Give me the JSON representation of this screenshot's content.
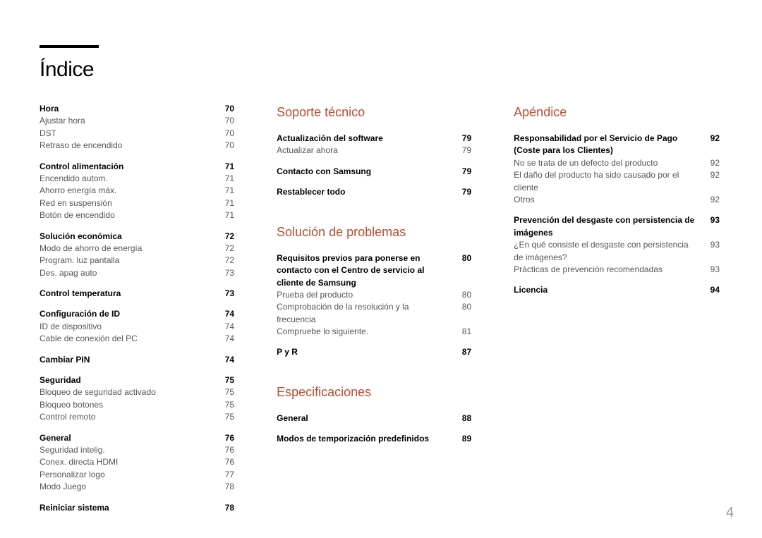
{
  "title": "Índice",
  "page_number": "4",
  "col1": {
    "groups": [
      {
        "items": [
          {
            "label": "Hora",
            "page": "70",
            "bold": true
          },
          {
            "label": "Ajustar hora",
            "page": "70"
          },
          {
            "label": "DST",
            "page": "70"
          },
          {
            "label": "Retraso de encendido",
            "page": "70"
          }
        ]
      },
      {
        "items": [
          {
            "label": "Control alimentación",
            "page": "71",
            "bold": true
          },
          {
            "label": "Encendido autom.",
            "page": "71"
          },
          {
            "label": "Ahorro energía máx.",
            "page": "71"
          },
          {
            "label": "Red en suspensión",
            "page": "71"
          },
          {
            "label": "Botón de encendido",
            "page": "71"
          }
        ]
      },
      {
        "items": [
          {
            "label": "Solución económica",
            "page": "72",
            "bold": true
          },
          {
            "label": "Modo de ahorro de energía",
            "page": "72"
          },
          {
            "label": "Program. luz pantalla",
            "page": "72"
          },
          {
            "label": "Des. apag auto",
            "page": "73"
          }
        ]
      },
      {
        "items": [
          {
            "label": "Control temperatura",
            "page": "73",
            "bold": true
          }
        ]
      },
      {
        "items": [
          {
            "label": "Configuración de ID",
            "page": "74",
            "bold": true
          },
          {
            "label": "ID de dispositivo",
            "page": "74"
          },
          {
            "label": "Cable de conexión del PC",
            "page": "74"
          }
        ]
      },
      {
        "items": [
          {
            "label": "Cambiar PIN",
            "page": "74",
            "bold": true
          }
        ]
      },
      {
        "items": [
          {
            "label": "Seguridad",
            "page": "75",
            "bold": true
          },
          {
            "label": "Bloqueo de seguridad activado",
            "page": "75"
          },
          {
            "label": "Bloqueo botones",
            "page": "75"
          },
          {
            "label": "Control remoto",
            "page": "75"
          }
        ]
      },
      {
        "items": [
          {
            "label": "General",
            "page": "76",
            "bold": true
          },
          {
            "label": "Seguridad intelig.",
            "page": "76"
          },
          {
            "label": "Conex. directa HDMI",
            "page": "76"
          },
          {
            "label": "Personalizar logo",
            "page": "77"
          },
          {
            "label": "Modo Juego",
            "page": "78"
          }
        ]
      },
      {
        "items": [
          {
            "label": "Reiniciar sistema",
            "page": "78",
            "bold": true
          }
        ]
      }
    ]
  },
  "col2": {
    "sections": [
      {
        "heading": "Soporte técnico",
        "groups": [
          {
            "items": [
              {
                "label": "Actualización del software",
                "page": "79",
                "bold": true
              },
              {
                "label": "Actualizar ahora",
                "page": "79"
              }
            ]
          },
          {
            "items": [
              {
                "label": "Contacto con Samsung",
                "page": "79",
                "bold": true
              }
            ]
          },
          {
            "items": [
              {
                "label": "Restablecer todo",
                "page": "79",
                "bold": true
              }
            ]
          }
        ]
      },
      {
        "heading": "Solución de problemas",
        "groups": [
          {
            "items": [
              {
                "label": "Requisitos previos para ponerse en contacto con el Centro de servicio al cliente de Samsung",
                "page": "80",
                "bold": true
              },
              {
                "label": "Prueba del producto",
                "page": "80"
              },
              {
                "label": "Comprobación de la resolución y la frecuencia",
                "page": "80"
              },
              {
                "label": "Compruebe lo siguiente.",
                "page": "81"
              }
            ]
          },
          {
            "items": [
              {
                "label": "P y R",
                "page": "87",
                "bold": true
              }
            ]
          }
        ]
      },
      {
        "heading": "Especificaciones",
        "groups": [
          {
            "items": [
              {
                "label": "General",
                "page": "88",
                "bold": true
              }
            ]
          },
          {
            "items": [
              {
                "label": "Modos de temporización predefinidos",
                "page": "89",
                "bold": true
              }
            ]
          }
        ]
      }
    ]
  },
  "col3": {
    "sections": [
      {
        "heading": "Apéndice",
        "groups": [
          {
            "items": [
              {
                "label": "Responsabilidad por el Servicio de Pago (Coste para los Clientes)",
                "page": "92",
                "bold": true
              },
              {
                "label": "No se trata de un defecto del producto",
                "page": "92"
              },
              {
                "label": "El daño del producto ha sido causado por el cliente",
                "page": "92"
              },
              {
                "label": "Otros",
                "page": "92"
              }
            ]
          },
          {
            "items": [
              {
                "label": "Prevención del desgaste con persistencia de imágenes",
                "page": "93",
                "bold": true
              },
              {
                "label": "¿En qué consiste el desgaste con persistencia de imágenes?",
                "page": "93"
              },
              {
                "label": "Prácticas de prevención recomendadas",
                "page": "93"
              }
            ]
          },
          {
            "items": [
              {
                "label": "Licencia",
                "page": "94",
                "bold": true
              }
            ]
          }
        ]
      }
    ]
  }
}
